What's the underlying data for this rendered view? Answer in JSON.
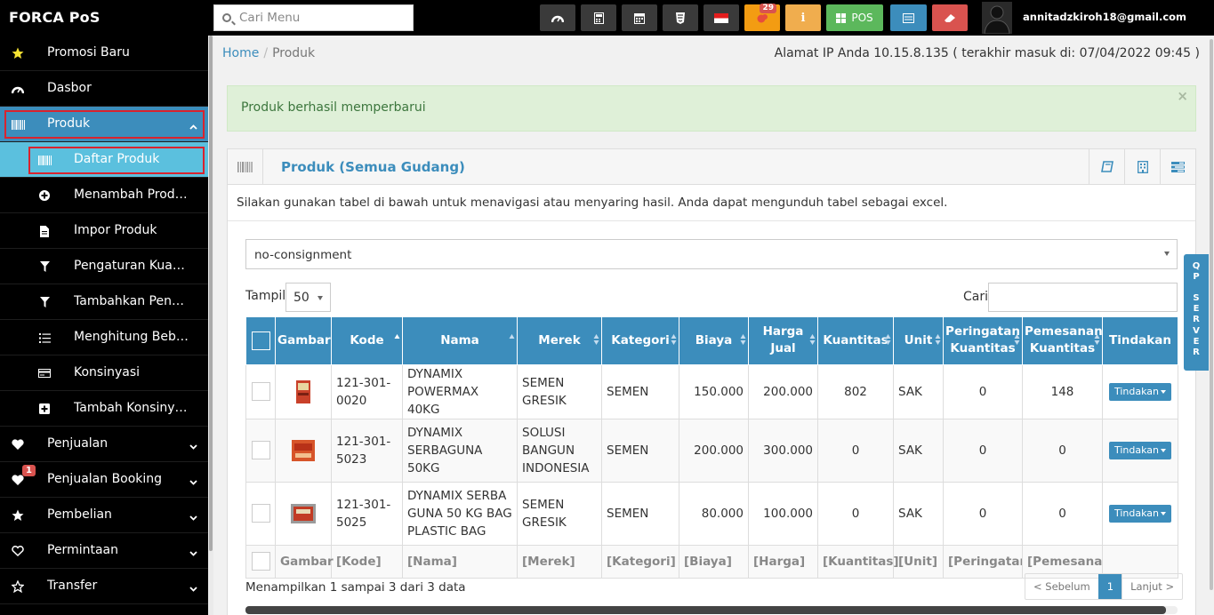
{
  "app": {
    "brand": "FORCA PoS"
  },
  "topbar": {
    "search_placeholder": "Cari Menu",
    "notification_count": "29",
    "pos_label": "POS",
    "user_email": "annitadzkiroh18@gmail.com",
    "colors": {
      "dark": "#3a3a3a",
      "orange": "#f39c12",
      "green": "#5cb85c",
      "blue": "#3c8dbc",
      "red": "#d9534f"
    }
  },
  "sidebar": {
    "items": [
      {
        "label": "Promosi Baru",
        "icon": "star-icon"
      },
      {
        "label": "Dasbor",
        "icon": "dashboard-icon"
      },
      {
        "label": "Produk",
        "icon": "barcode-icon"
      },
      {
        "label": "Daftar Produk",
        "icon": "barcode-icon"
      },
      {
        "label": "Menambah Produk",
        "icon": "plus-circle-icon"
      },
      {
        "label": "Impor Produk",
        "icon": "file-icon"
      },
      {
        "label": "Pengaturan Kuantitas",
        "icon": "filter-icon"
      },
      {
        "label": "Tambahkan Penyesuaian",
        "icon": "filter-icon"
      },
      {
        "label": "Menghitung Beban",
        "icon": "list-icon"
      },
      {
        "label": "Konsinyasi",
        "icon": "card-icon"
      },
      {
        "label": "Tambah Konsinyasi",
        "icon": "plus-square-icon"
      },
      {
        "label": "Penjualan",
        "icon": "heart-icon"
      },
      {
        "label": "Penjualan Booking",
        "icon": "heart-icon",
        "badge": "1"
      },
      {
        "label": "Pembelian",
        "icon": "star-icon"
      },
      {
        "label": "Permintaan",
        "icon": "heart-outline-icon"
      },
      {
        "label": "Transfer",
        "icon": "star-outline-icon"
      }
    ]
  },
  "breadcrumb": {
    "home": "Home",
    "current": "Produk"
  },
  "ip_info": "Alamat IP Anda 10.15.8.135 ( terakhir masuk di: 07/04/2022 09:45 )",
  "alert": {
    "message": "Produk berhasil memperbarui",
    "close": "×"
  },
  "panel": {
    "title": "Produk (Semua Gudang)",
    "intro": "Silakan gunakan tabel di bawah untuk menavigasi atau menyaring hasil. Anda dapat mengunduh tabel sebagai excel.",
    "warehouse_filter": "no-consignment",
    "show_label": "Tampil",
    "page_length": "50",
    "search_label": "Cari"
  },
  "table": {
    "headers": [
      "Gambar",
      "Kode",
      "Nama",
      "Merek",
      "Kategori",
      "Biaya",
      "Harga Jual",
      "Kuantitas",
      "Unit",
      "Peringatan Kuantitas",
      "Pemesanan Kuantitas",
      "Tindakan"
    ],
    "rows": [
      {
        "kode": "121-301-0020",
        "nama": "DYNAMIX POWERMAX 40KG",
        "merek": "SEMEN GRESIK",
        "kategori": "SEMEN",
        "biaya": "150.000",
        "harga": "200.000",
        "kuantitas": "802",
        "unit": "SAK",
        "peringatan": "0",
        "pemesanan": "148",
        "action": "Tindakan"
      },
      {
        "kode": "121-301-5023",
        "nama": "DYNAMIX SERBAGUNA 50KG",
        "merek": "SOLUSI BANGUN INDONESIA",
        "kategori": "SEMEN",
        "biaya": "200.000",
        "harga": "300.000",
        "kuantitas": "0",
        "unit": "SAK",
        "peringatan": "0",
        "pemesanan": "0",
        "action": "Tindakan"
      },
      {
        "kode": "121-301-5025",
        "nama": "DYNAMIX SERBA GUNA 50 KG BAG PLASTIC BAG",
        "merek": "SEMEN GRESIK",
        "kategori": "SEMEN",
        "biaya": "80.000",
        "harga": "100.000",
        "kuantitas": "0",
        "unit": "SAK",
        "peringatan": "0",
        "pemesanan": "0",
        "action": "Tindakan"
      }
    ],
    "footer": [
      "Gambar",
      "[Kode]",
      "[Nama]",
      "[Merek]",
      "[Kategori]",
      "[Biaya]",
      "[Harga]",
      "[Kuantitas]",
      "[Unit]",
      "[Peringatan",
      "[Pemesanan"
    ]
  },
  "pagination": {
    "info": "Menampilkan 1 sampai 3 dari 3 data",
    "prev": "< Sebelum",
    "current": "1",
    "next": "Lanjut >"
  },
  "side_tab": {
    "label": "QP SERVER"
  }
}
